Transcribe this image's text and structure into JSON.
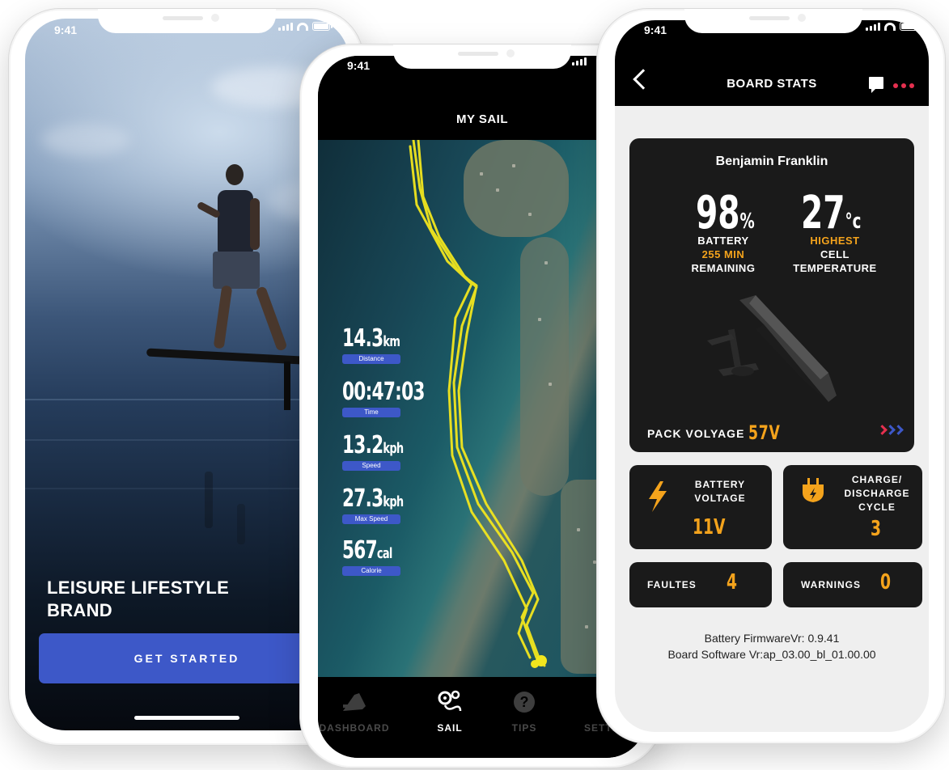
{
  "status": {
    "time": "9:41"
  },
  "welcome": {
    "brand_line1": "LEISURE LIFESTYLE",
    "brand_line2": "BRAND",
    "cta_label": "GET STARTED"
  },
  "sail": {
    "title": "MY SAIL",
    "stats": [
      {
        "value": "14.3",
        "unit": "km",
        "label": "Distance"
      },
      {
        "value": "00:47:03",
        "unit": "",
        "label": "Time"
      },
      {
        "value": "13.2",
        "unit": "kph",
        "label": "Speed"
      },
      {
        "value": "27.3",
        "unit": "kph",
        "label": "Max Speed"
      },
      {
        "value": "567",
        "unit": "cal",
        "label": "Calorie"
      }
    ],
    "tabs": [
      {
        "label": "DASHBOARD",
        "icon": "board-icon",
        "active": false
      },
      {
        "label": "SAIL",
        "icon": "route-pin-icon",
        "active": true
      },
      {
        "label": "TIPS",
        "icon": "question-icon",
        "active": false
      },
      {
        "label": "SETTINGS",
        "icon": "gear-icon",
        "active": false
      }
    ],
    "track_color": "#f2e61e"
  },
  "board_stats": {
    "title": "BOARD STATS",
    "owner": "Benjamin Franklin",
    "battery": {
      "value": "98",
      "unit": "%",
      "caption_top": "BATTERY",
      "remaining": "255 MIN",
      "caption_bottom": "REMAINING"
    },
    "temperature": {
      "value": "27",
      "unit": "°c",
      "caption_top": "HIGHEST",
      "caption_mid": "CELL",
      "caption_bottom": "TEMPERATURE"
    },
    "pack_label": "PACK VOLYAGE",
    "pack_value": "57V",
    "battery_voltage": {
      "label_1": "BATTERY",
      "label_2": "VOLTAGE",
      "value": "11V"
    },
    "charge_cycle": {
      "label_1": "CHARGE/",
      "label_2": "DISCHARGE",
      "label_3": "CYCLE",
      "value": "3"
    },
    "faults": {
      "label": "FAULTES",
      "value": "4"
    },
    "warnings": {
      "label": "WARNINGS",
      "value": "0"
    },
    "firmware_line1": "Battery FirmwareVr: 0.9.41",
    "firmware_line2": "Board Software Vr:ap_03.00_bl_01.00.00"
  },
  "colors": {
    "accent_blue": "#3d58c8",
    "accent_orange": "#f4a31c",
    "menu_red": "#e5304f"
  }
}
